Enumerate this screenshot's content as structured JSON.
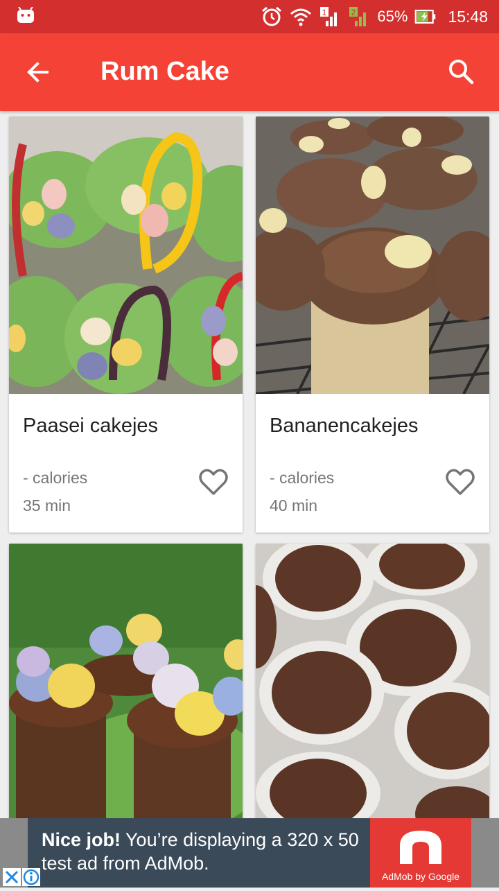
{
  "status_bar": {
    "battery": "65%",
    "time": "15:48",
    "sim1": "1",
    "sim2": "2"
  },
  "app_bar": {
    "title": "Rum Cake"
  },
  "recipes": [
    {
      "title": "Paasei cakejes",
      "calories": "- calories",
      "time": "35 min"
    },
    {
      "title": "Bananencakejes",
      "calories": "- calories",
      "time": "40 min"
    },
    {
      "title": "",
      "calories": "",
      "time": ""
    },
    {
      "title": "",
      "calories": "",
      "time": ""
    }
  ],
  "ad": {
    "bold": "Nice job!",
    "text": " You’re displaying a 320 x 50 test ad from AdMob.",
    "brand": "AdMob by Google"
  },
  "colors": {
    "status_bar": "#d32f2f",
    "app_bar": "#f44336"
  }
}
